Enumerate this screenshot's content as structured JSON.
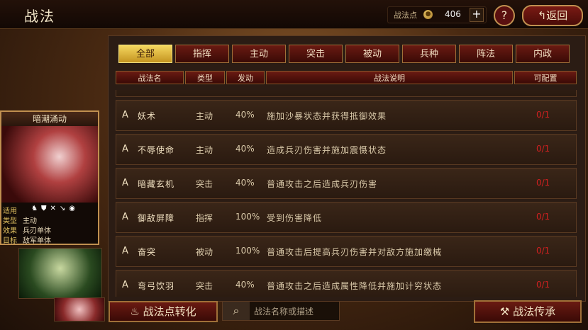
{
  "header": {
    "title": "战法",
    "points_label": "战法点",
    "points_value": "406",
    "plus_label": "+",
    "help_label": "?",
    "back_label": "返回"
  },
  "tabs": [
    "全部",
    "指挥",
    "主动",
    "突击",
    "被动",
    "兵种",
    "阵法",
    "内政"
  ],
  "active_tab": "全部",
  "columns": [
    "战法名",
    "类型",
    "发动",
    "战法说明",
    "可配置"
  ],
  "skills": [
    {
      "grade": "A",
      "name": "妖术",
      "type": "主动",
      "rate": "40%",
      "desc": "施加沙暴状态并获得抵御效果",
      "count": "0/1"
    },
    {
      "grade": "A",
      "name": "不辱使命",
      "type": "主动",
      "rate": "40%",
      "desc": "造成兵刃伤害并施加震慑状态",
      "count": "0/1"
    },
    {
      "grade": "A",
      "name": "暗藏玄机",
      "type": "突击",
      "rate": "40%",
      "desc": "普通攻击之后造成兵刃伤害",
      "count": "0/1"
    },
    {
      "grade": "A",
      "name": "御敌屏障",
      "type": "指挥",
      "rate": "100%",
      "desc": "受到伤害降低",
      "count": "0/1"
    },
    {
      "grade": "A",
      "name": "奋突",
      "type": "被动",
      "rate": "100%",
      "desc": "普通攻击后提高兵刃伤害并对敌方施加缴械",
      "count": "0/1"
    },
    {
      "grade": "A",
      "name": "弯弓饮羽",
      "type": "突击",
      "rate": "40%",
      "desc": "普通攻击之后造成属性降低并施加计穷状态",
      "count": "0/1"
    }
  ],
  "card": {
    "title": "暗潮涌动",
    "applicable_label": "适用",
    "troop_icons": "♞⛊✕↘◉",
    "type_label": "类型",
    "type_value": "主动",
    "effect_label": "效果",
    "effect_value": "兵刃单体",
    "target_label": "目标",
    "target_value": "敌军单体"
  },
  "footer": {
    "convert_label": "战法点转化",
    "search_placeholder": "战法名称或描述",
    "inherit_label": "战法传承"
  }
}
